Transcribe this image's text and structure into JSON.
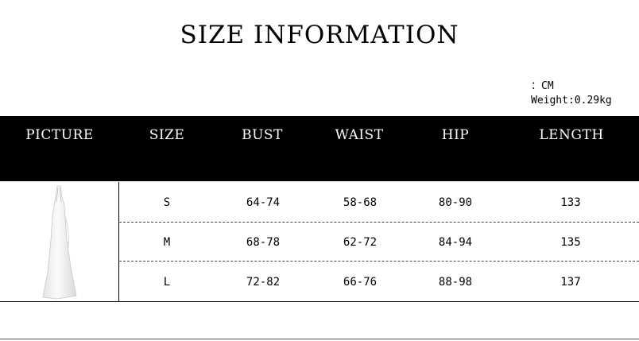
{
  "title": "SIZE INFORMATION",
  "unit_line": "：CM",
  "weight_line": "Weight:0.29kg",
  "columns": [
    "PICTURE",
    "SIZE",
    "BUST",
    "WAIST",
    "HIP",
    "LENGTH"
  ],
  "rows": [
    {
      "size": "S",
      "bust": "64-74",
      "waist": "58-68",
      "hip": "80-90",
      "length": "133"
    },
    {
      "size": "M",
      "bust": "68-78",
      "waist": "62-72",
      "hip": "84-94",
      "length": "135"
    },
    {
      "size": "L",
      "bust": "72-82",
      "waist": "66-76",
      "hip": "88-98",
      "length": "137"
    }
  ],
  "picture": {
    "icon": "white-halter-maxi-dress-image",
    "color": "#f2f2f2"
  }
}
